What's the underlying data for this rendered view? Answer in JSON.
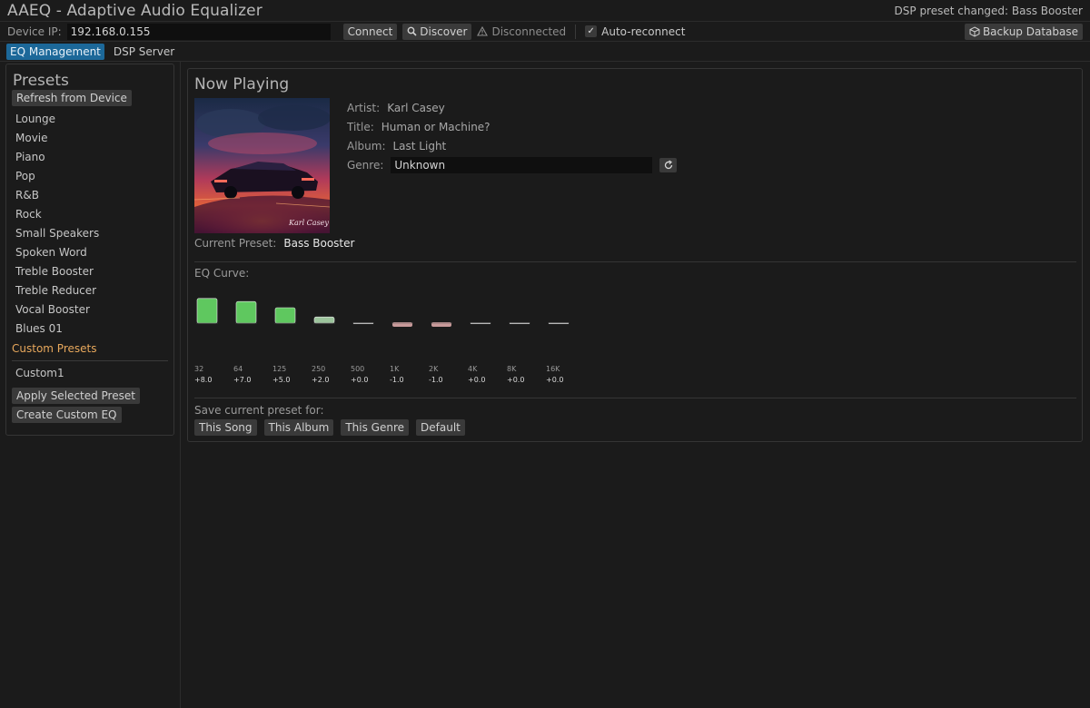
{
  "app": {
    "title": "AAEQ - Adaptive Audio Equalizer",
    "status_message": "DSP preset changed: Bass Booster"
  },
  "toolbar": {
    "device_ip_label": "Device IP:",
    "device_ip_value": "192.168.0.155",
    "connect_label": "Connect",
    "discover_label": "Discover",
    "connection_status": "Disconnected",
    "auto_reconnect_label": "Auto-reconnect",
    "auto_reconnect_checked": true,
    "backup_label": "Backup Database"
  },
  "tabs": [
    {
      "label": "EQ Management",
      "active": true
    },
    {
      "label": "DSP Server",
      "active": false
    }
  ],
  "presets": {
    "heading": "Presets",
    "refresh_label": "Refresh from Device",
    "items": [
      "Lounge",
      "Movie",
      "Piano",
      "Pop",
      "R&B",
      "Rock",
      "Small Speakers",
      "Spoken Word",
      "Treble Booster",
      "Treble Reducer",
      "Vocal Booster",
      "Blues 01"
    ],
    "custom_heading": "Custom Presets",
    "custom_items": [
      "Custom1"
    ],
    "apply_label": "Apply Selected Preset",
    "create_label": "Create Custom EQ"
  },
  "now_playing": {
    "heading": "Now Playing",
    "artist_label": "Artist:",
    "artist": "Karl Casey",
    "title_label": "Title:",
    "title": "Human or Machine?",
    "album_label": "Album:",
    "album": "Last Light",
    "genre_label": "Genre:",
    "genre": "Unknown",
    "current_preset_label": "Current Preset:",
    "current_preset": "Bass Booster",
    "art_signature": "Karl Casey"
  },
  "eq": {
    "label": "EQ Curve:",
    "bands": [
      {
        "freq": "32",
        "gain": 8.0,
        "gain_label": "+8.0"
      },
      {
        "freq": "64",
        "gain": 7.0,
        "gain_label": "+7.0"
      },
      {
        "freq": "125",
        "gain": 5.0,
        "gain_label": "+5.0"
      },
      {
        "freq": "250",
        "gain": 2.0,
        "gain_label": "+2.0"
      },
      {
        "freq": "500",
        "gain": 0.0,
        "gain_label": "+0.0"
      },
      {
        "freq": "1K",
        "gain": -1.0,
        "gain_label": "-1.0"
      },
      {
        "freq": "2K",
        "gain": -1.0,
        "gain_label": "-1.0"
      },
      {
        "freq": "4K",
        "gain": 0.0,
        "gain_label": "+0.0"
      },
      {
        "freq": "8K",
        "gain": 0.0,
        "gain_label": "+0.0"
      },
      {
        "freq": "16K",
        "gain": 0.0,
        "gain_label": "+0.0"
      }
    ],
    "colors": {
      "strong_boost": "#5fc85f",
      "light_boost": "#9cc49c",
      "cut": "#c89a9a",
      "flat": "#d8d8d8"
    }
  },
  "save": {
    "label": "Save current preset for:",
    "buttons": [
      "This Song",
      "This Album",
      "This Genre",
      "Default"
    ]
  },
  "colors": {
    "accent": "#1c6899",
    "custom_heading": "#e8a85c",
    "background": "#1b1b1b"
  }
}
